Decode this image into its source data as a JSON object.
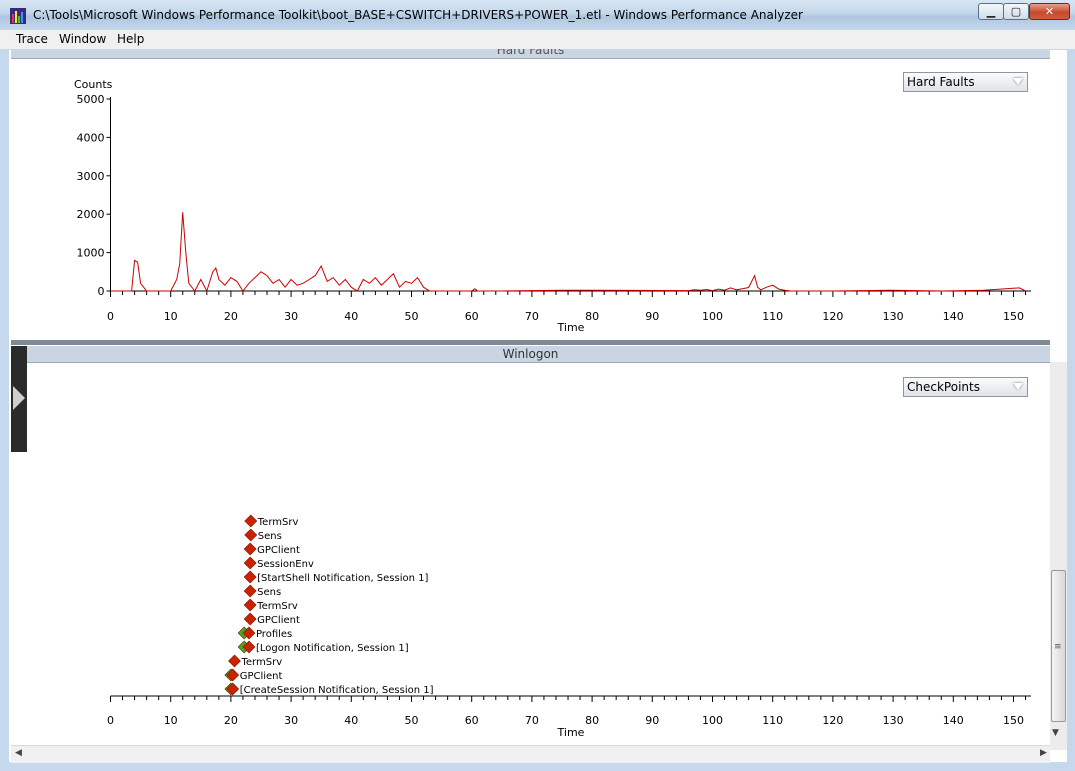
{
  "window": {
    "title": "C:\\Tools\\Microsoft Windows Performance Toolkit\\boot_BASE+CSWITCH+DRIVERS+POWER_1.etl - Windows Performance Analyzer",
    "minimize_glyph": "▁",
    "maximize_glyph": "▢",
    "close_glyph": "✕"
  },
  "menu": {
    "items": [
      "Trace",
      "Window",
      "Help"
    ]
  },
  "hard_faults_panel": {
    "header": "Hard Faults",
    "dropdown_value": "Hard Faults",
    "chart_data": {
      "type": "line",
      "ylabel": "Counts",
      "xlabel": "Time",
      "xlim": [
        0,
        152
      ],
      "ylim": [
        0,
        5000
      ],
      "y_ticks": [
        "5000",
        "4000",
        "3000",
        "2000",
        "1000",
        "0"
      ],
      "x_ticks": [
        "0",
        "10",
        "20",
        "30",
        "40",
        "50",
        "60",
        "70",
        "80",
        "90",
        "100",
        "110",
        "120",
        "130",
        "140",
        "150"
      ],
      "line_color": "#cc0000",
      "series": [
        {
          "x": [
            0,
            3.5,
            4,
            4.5,
            5,
            6,
            7,
            8,
            10,
            11,
            11.5,
            12,
            12.5,
            13,
            14,
            15,
            16,
            17,
            17.5,
            18,
            19,
            20,
            21,
            22,
            23,
            24,
            25,
            26,
            27,
            28,
            29,
            30,
            31,
            32,
            33,
            34,
            35,
            36,
            37,
            38,
            39,
            40,
            41,
            42,
            43,
            44,
            45,
            46,
            47,
            48,
            49,
            50,
            51,
            52,
            53,
            54,
            55,
            60,
            60.5,
            61,
            65,
            75,
            80,
            96,
            97,
            98,
            99,
            100,
            101,
            102,
            103,
            104,
            105,
            106,
            107,
            107.5,
            108,
            109,
            110,
            111,
            112,
            113,
            114,
            120,
            130,
            138,
            145,
            151,
            152,
            153
          ],
          "y": [
            0,
            0,
            800,
            750,
            200,
            0,
            0,
            0,
            0,
            300,
            700,
            2050,
            1000,
            200,
            0,
            300,
            0,
            500,
            600,
            300,
            150,
            350,
            250,
            0,
            200,
            350,
            500,
            400,
            200,
            300,
            100,
            300,
            150,
            200,
            300,
            400,
            650,
            250,
            350,
            150,
            300,
            100,
            0,
            300,
            200,
            350,
            150,
            300,
            450,
            100,
            250,
            200,
            350,
            100,
            0,
            0,
            0,
            0,
            60,
            0,
            0,
            20,
            20,
            10,
            30,
            20,
            40,
            10,
            50,
            20,
            80,
            30,
            60,
            90,
            400,
            100,
            30,
            100,
            150,
            50,
            20,
            0,
            0,
            0,
            20,
            0,
            20,
            80,
            0
          ]
        }
      ]
    }
  },
  "winlogon_panel": {
    "header": "Winlogon",
    "dropdown_value": "CheckPoints",
    "chart_data": {
      "type": "scatter",
      "xlabel": "Time",
      "xlim": [
        0,
        152
      ],
      "x_ticks": [
        "0",
        "10",
        "20",
        "30",
        "40",
        "50",
        "60",
        "70",
        "80",
        "90",
        "100",
        "110",
        "120",
        "130",
        "140",
        "150"
      ],
      "points": [
        {
          "label": "TermSrv",
          "x": 23.3,
          "color": "#cc2200"
        },
        {
          "label": "Sens",
          "x": 23.3,
          "color": "#cc2200"
        },
        {
          "label": "GPClient",
          "x": 23.2,
          "color": "#cc2200"
        },
        {
          "label": "SessionEnv",
          "x": 23.2,
          "color": "#cc2200"
        },
        {
          "label": "[StartShell Notification, Session 1]",
          "x": 23.2,
          "color": "#cc2200"
        },
        {
          "label": "Sens",
          "x": 23.2,
          "color": "#cc2200"
        },
        {
          "label": "TermSrv",
          "x": 23.2,
          "color": "#cc2200"
        },
        {
          "label": "GPClient",
          "x": 23.2,
          "color": "#cc2200"
        },
        {
          "label": "Profiles",
          "x": 23.0,
          "color": "#cc2200",
          "start_x": 22.2,
          "start_color": "#44aa22"
        },
        {
          "label": "[Logon Notification, Session 1]",
          "x": 23.0,
          "color": "#cc2200",
          "start_x": 22.2,
          "start_color": "#44aa22"
        },
        {
          "label": "TermSrv",
          "x": 20.6,
          "color": "#cc2200"
        },
        {
          "label": "GPClient",
          "x": 20.3,
          "color": "#cc2200",
          "start_x": 20.0,
          "start_color": "#44aa22"
        },
        {
          "label": "[CreateSession Notification, Session 1]",
          "x": 20.3,
          "color": "#cc2200",
          "start_x": 20.0,
          "start_color": "#44aa22"
        }
      ]
    }
  }
}
